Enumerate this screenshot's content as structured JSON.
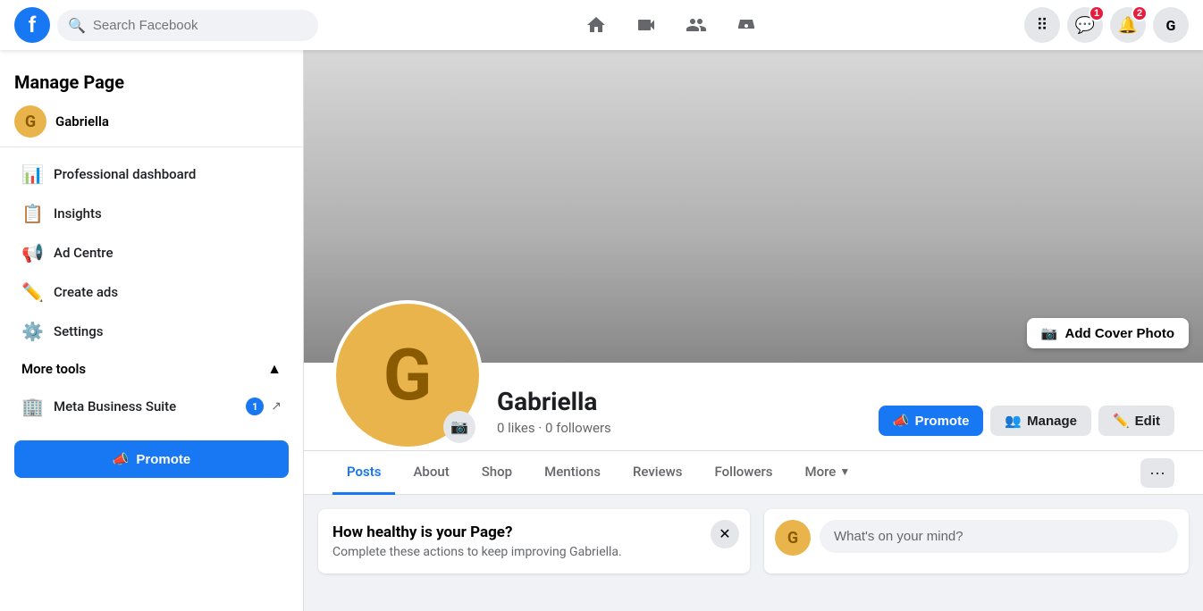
{
  "topnav": {
    "logo": "f",
    "search_placeholder": "Search Facebook",
    "nav_icons": [
      "home",
      "video",
      "people",
      "marketplace"
    ],
    "messenger_badge": "1",
    "notifications_badge": "2",
    "user_initial": "G"
  },
  "sidebar": {
    "title": "Manage Page",
    "user_initial": "G",
    "username": "Gabriella",
    "menu_items": [
      {
        "label": "Professional dashboard",
        "icon": "📊"
      },
      {
        "label": "Insights",
        "icon": "📋"
      },
      {
        "label": "Ad Centre",
        "icon": "📢"
      },
      {
        "label": "Create ads",
        "icon": "✏️"
      },
      {
        "label": "Settings",
        "icon": "⚙️"
      }
    ],
    "more_tools_label": "More tools",
    "meta_business_label": "Meta Business Suite",
    "meta_business_badge": "1",
    "promote_label": "Promote"
  },
  "cover": {
    "add_cover_label": "Add Cover Photo"
  },
  "profile": {
    "initial": "G",
    "name": "Gabriella",
    "stats": "0 likes · 0 followers",
    "promote_label": "Promote",
    "manage_label": "Manage",
    "edit_label": "Edit"
  },
  "tabs": {
    "items": [
      {
        "label": "Posts",
        "active": true
      },
      {
        "label": "About"
      },
      {
        "label": "Shop"
      },
      {
        "label": "Mentions"
      },
      {
        "label": "Reviews"
      },
      {
        "label": "Followers"
      },
      {
        "label": "More"
      }
    ]
  },
  "health_card": {
    "title": "How healthy is your Page?",
    "description": "Complete these actions to keep improving Gabriella."
  },
  "post_box": {
    "user_initial": "G",
    "placeholder": "What's on your mind?"
  }
}
